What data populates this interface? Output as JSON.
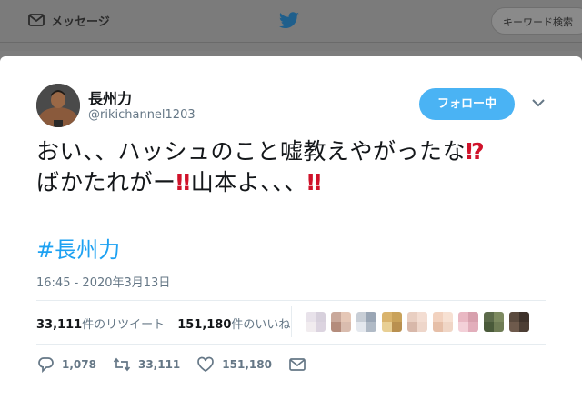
{
  "topbar": {
    "messages_label": "メッセージ",
    "search_placeholder": "キーワード検索"
  },
  "tweet": {
    "author_name": "長州力",
    "author_handle": "@rikichannel1203",
    "follow_label": "フォロー中",
    "text_line1": "おい、、ハッシュのこと嘘教えやがったな",
    "text_line1_emoji": "⁉",
    "text_line2_a": "ばかたれがー",
    "text_line2_emoji1": "‼",
    "text_line2_b": "山本よ、、、",
    "text_line2_emoji2": "‼",
    "hashtag": "#長州力",
    "timestamp": "16:45 - 2020年3月13日",
    "retweets_count": "33,111",
    "retweets_label": "件のリツイート",
    "likes_count": "151,180",
    "likes_label": "件のいいね",
    "reply_count": "1,078",
    "retweet_action_count": "33,111",
    "like_action_count": "151,180"
  },
  "colors": {
    "accent": "#1da1f2",
    "follow_bg": "#4ab3f4",
    "emoji_red": "#d0122a"
  },
  "icons": {
    "messages": "envelope-icon",
    "brand": "twitter-bird-icon",
    "more": "chevron-down-icon",
    "reply": "reply-icon",
    "retweet": "retweet-icon",
    "like": "heart-icon",
    "dm": "envelope-icon"
  }
}
